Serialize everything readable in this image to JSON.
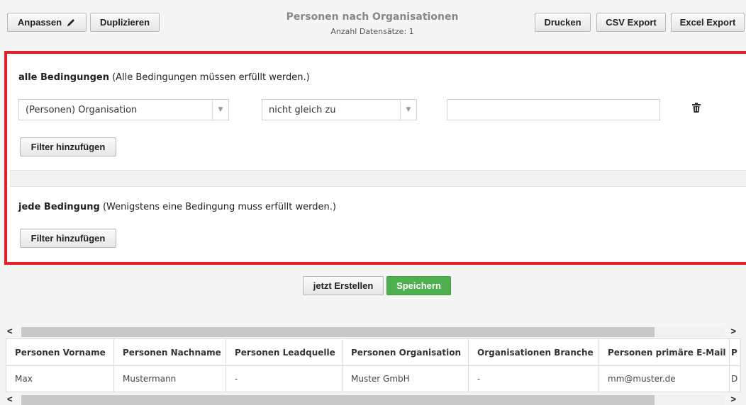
{
  "toolbar": {
    "customize_label": "Anpassen",
    "duplicate_label": "Duplizieren",
    "print_label": "Drucken",
    "csv_label": "CSV Export",
    "excel_label": "Excel Export"
  },
  "report": {
    "title": "Personen nach Organisationen",
    "record_count": "Anzahl Datensätze: 1"
  },
  "filters": {
    "all": {
      "heading": "alle Bedingungen",
      "hint": "(Alle Bedingungen müssen erfüllt werden.)",
      "field_value": "(Personen) Organisation",
      "operator_value": "nicht gleich zu",
      "value": "",
      "add_label": "Filter hinzufügen"
    },
    "any": {
      "heading": "jede Bedingung",
      "hint": "(Wenigstens eine Bedingung muss erfüllt werden.)",
      "add_label": "Filter hinzufügen"
    }
  },
  "actions": {
    "create_label": "jetzt Erstellen",
    "save_label": "Speichern"
  },
  "table": {
    "columns": [
      "Personen Vorname",
      "Personen Nachname",
      "Personen Leadquelle",
      "Personen Organisation",
      "Organisationen Branche",
      "Personen primäre E-Mail",
      "P"
    ],
    "rows": [
      [
        "Max",
        "Mustermann",
        "-",
        "Muster GmbH",
        "-",
        "mm@muster.de",
        "D"
      ]
    ]
  },
  "icons": {
    "customize": "pencil-icon",
    "delete": "trash-icon",
    "scroll_left": "chevron-left-icon",
    "scroll_right": "chevron-right-icon",
    "dropdown": "chevron-down-icon"
  },
  "colors": {
    "highlight_border": "#e2222a",
    "save_button": "#4fb04f"
  }
}
